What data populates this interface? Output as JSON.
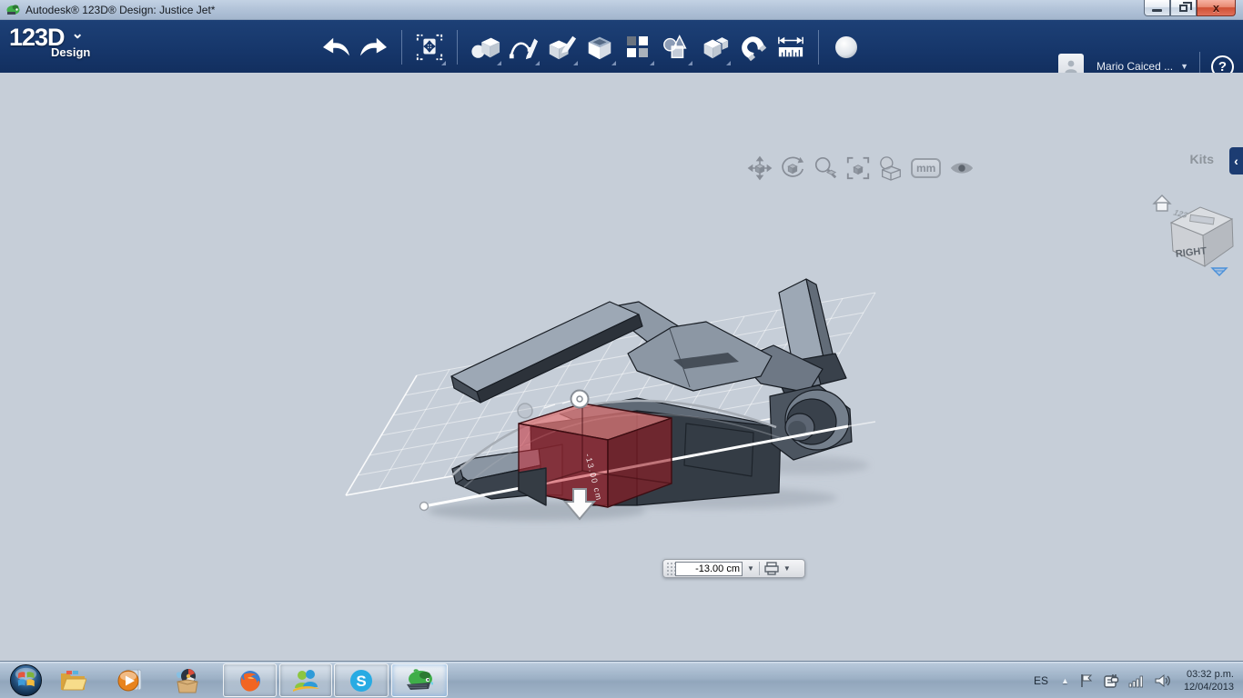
{
  "window": {
    "title": "Autodesk® 123D® Design: Justice Jet*",
    "controls": [
      "minimize",
      "restore",
      "close"
    ]
  },
  "appbar": {
    "logo": "123D",
    "logo_sub": "Design",
    "logo_chevron": "⌄",
    "tool_icons": [
      "undo",
      "redo",
      "transform-move",
      "primitives",
      "sketch",
      "tweak",
      "construct-shell",
      "pattern",
      "group",
      "combine",
      "snap-magnet",
      "measure-ruler",
      "material-sphere"
    ],
    "user_name": "Mario Caiced ...",
    "user_caret": "▼",
    "help_glyph": "?"
  },
  "viewbar": {
    "tool_icons": [
      "pan",
      "orbit",
      "zoom",
      "fit-view",
      "material-render",
      "units",
      "visibility-eye"
    ],
    "units_label": "mm"
  },
  "right_panel": {
    "kits_label": "Kits",
    "collapse_glyph": "‹"
  },
  "viewcube": {
    "front_face": "RIGHT",
    "top_face": "123"
  },
  "scene": {
    "selected_part": "red transparent box on jet fuselage",
    "dimension_value": "-13.00 cm",
    "dimension_caret": "▼",
    "snap_caret": "▼"
  },
  "taskbar": {
    "app_icons": [
      "start-orb",
      "windows-explorer",
      "media-player",
      "catch-box",
      "firefox",
      "messenger",
      "skype",
      "123d-design-app"
    ],
    "running_apps": [
      "firefox",
      "messenger",
      "skype",
      "123d-design-app"
    ],
    "active_app": "123d-design-app",
    "skype_glyph": "S",
    "tray": {
      "language": "ES",
      "hidden_icons_glyph": "▲",
      "tray_icons": [
        "action-center-flag",
        "power-plug",
        "network-signal",
        "volume-speaker"
      ],
      "time": "03:32 p.m.",
      "date": "12/04/2013"
    }
  },
  "colors": {
    "appbar_navy": "#16366a",
    "canvas_gray": "#c6ced8",
    "selection_red": "#c0392b",
    "grid_white": "#ffffff"
  }
}
